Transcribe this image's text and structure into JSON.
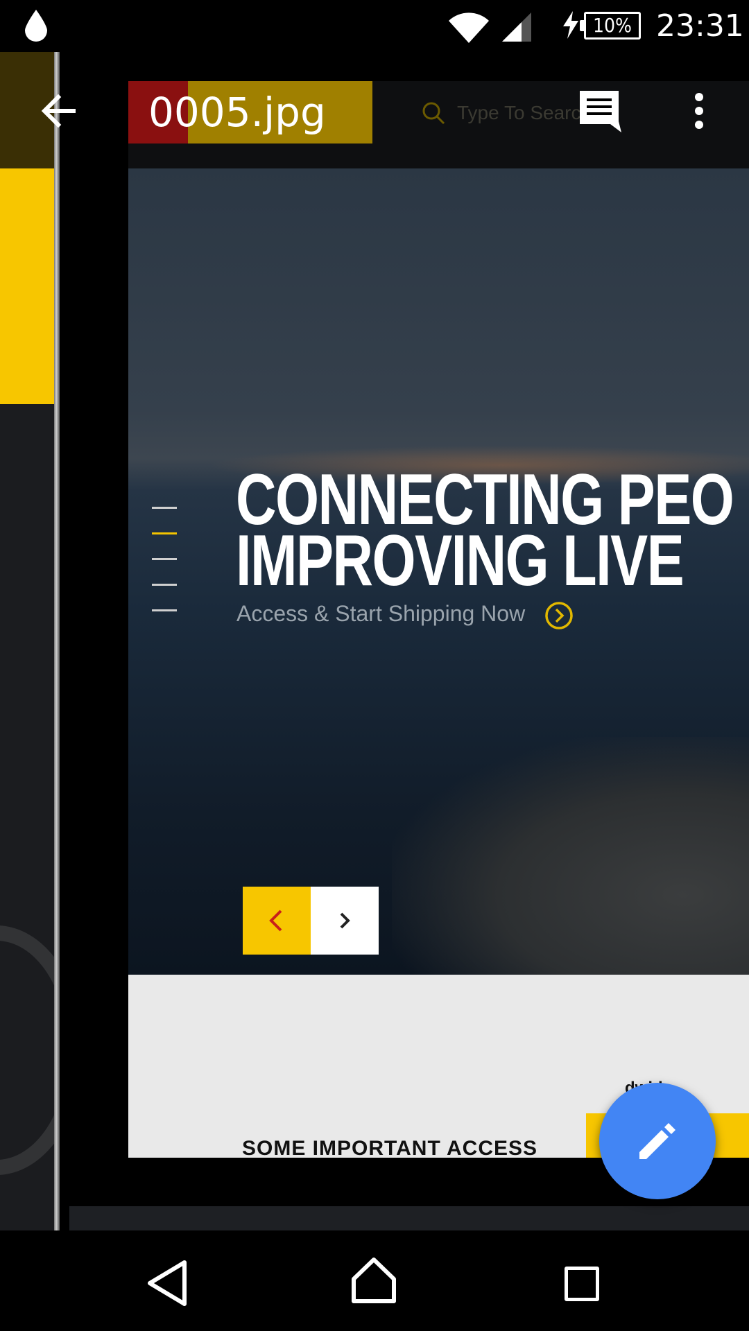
{
  "status_bar": {
    "battery": "10%",
    "time": "23:31",
    "icons": [
      "drop-icon",
      "wifi-icon",
      "cell-signal-icon",
      "charging-bolt-icon",
      "battery-icon"
    ]
  },
  "toolbar": {
    "title": "0005.jpg",
    "icons": [
      "arrow-back-icon",
      "comment-icon",
      "more-vert-icon"
    ]
  },
  "image_content": {
    "search_placeholder": "Type To Search",
    "headline_line1": "CONNECTING PEO",
    "headline_line2": "IMPROVING LIVE",
    "cta_text": "Access & Start Shipping Now",
    "worldwide_text": "dwide",
    "important_text": "SOME IMPORTANT ACCESS"
  },
  "fab": {
    "icon": "edit-pencil-icon",
    "color": "#4285f4"
  },
  "nav_bar": {
    "icons": [
      "nav-back-icon",
      "nav-home-icon",
      "nav-recents-icon"
    ]
  },
  "colors": {
    "accent_yellow": "#f7c600",
    "fab_blue": "#4285f4"
  }
}
